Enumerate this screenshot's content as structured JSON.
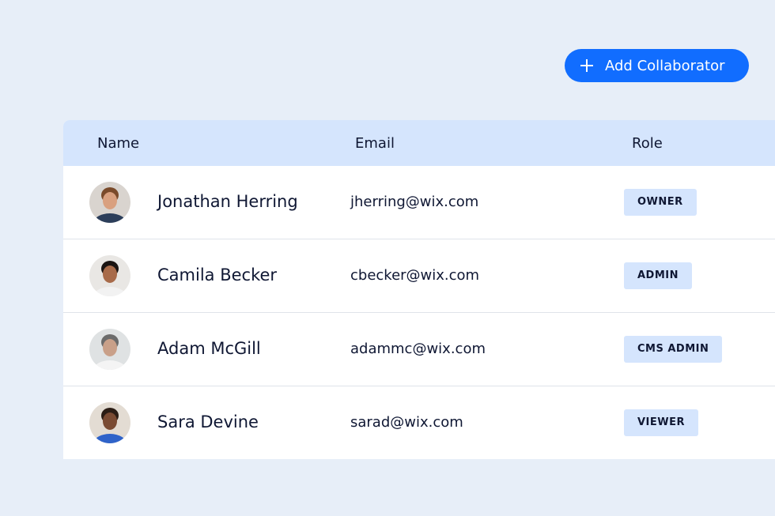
{
  "toolbar": {
    "add_label": "Add Collaborator",
    "add_icon": "plus-icon",
    "accent": "#116dff"
  },
  "table": {
    "headers": {
      "name": "Name",
      "email": "Email",
      "role": "Role"
    },
    "rows": [
      {
        "name": "Jonathan Herring",
        "email": "jherring@wix.com",
        "role": "OWNER",
        "avatar": {
          "bg": "#d9d4cf",
          "skin": "#d9a07f",
          "hair": "#7a4a2a",
          "shirt": "#2c3e5a"
        }
      },
      {
        "name": "Camila Becker",
        "email": "cbecker@wix.com",
        "role": "ADMIN",
        "avatar": {
          "bg": "#e9e7e4",
          "skin": "#a86b4a",
          "hair": "#1a1412",
          "shirt": "#f2f2f2"
        }
      },
      {
        "name": "Adam McGill",
        "email": "adammc@wix.com",
        "role": "CMS ADMIN",
        "avatar": {
          "bg": "#dfe2e3",
          "skin": "#c9a089",
          "hair": "#6b6b6b",
          "shirt": "#f4f4f4"
        }
      },
      {
        "name": "Sara Devine",
        "email": "sarad@wix.com",
        "role": "VIEWER",
        "avatar": {
          "bg": "#e3dcd3",
          "skin": "#7a4b33",
          "hair": "#2b1d15",
          "shirt": "#2f63c9"
        }
      }
    ]
  }
}
